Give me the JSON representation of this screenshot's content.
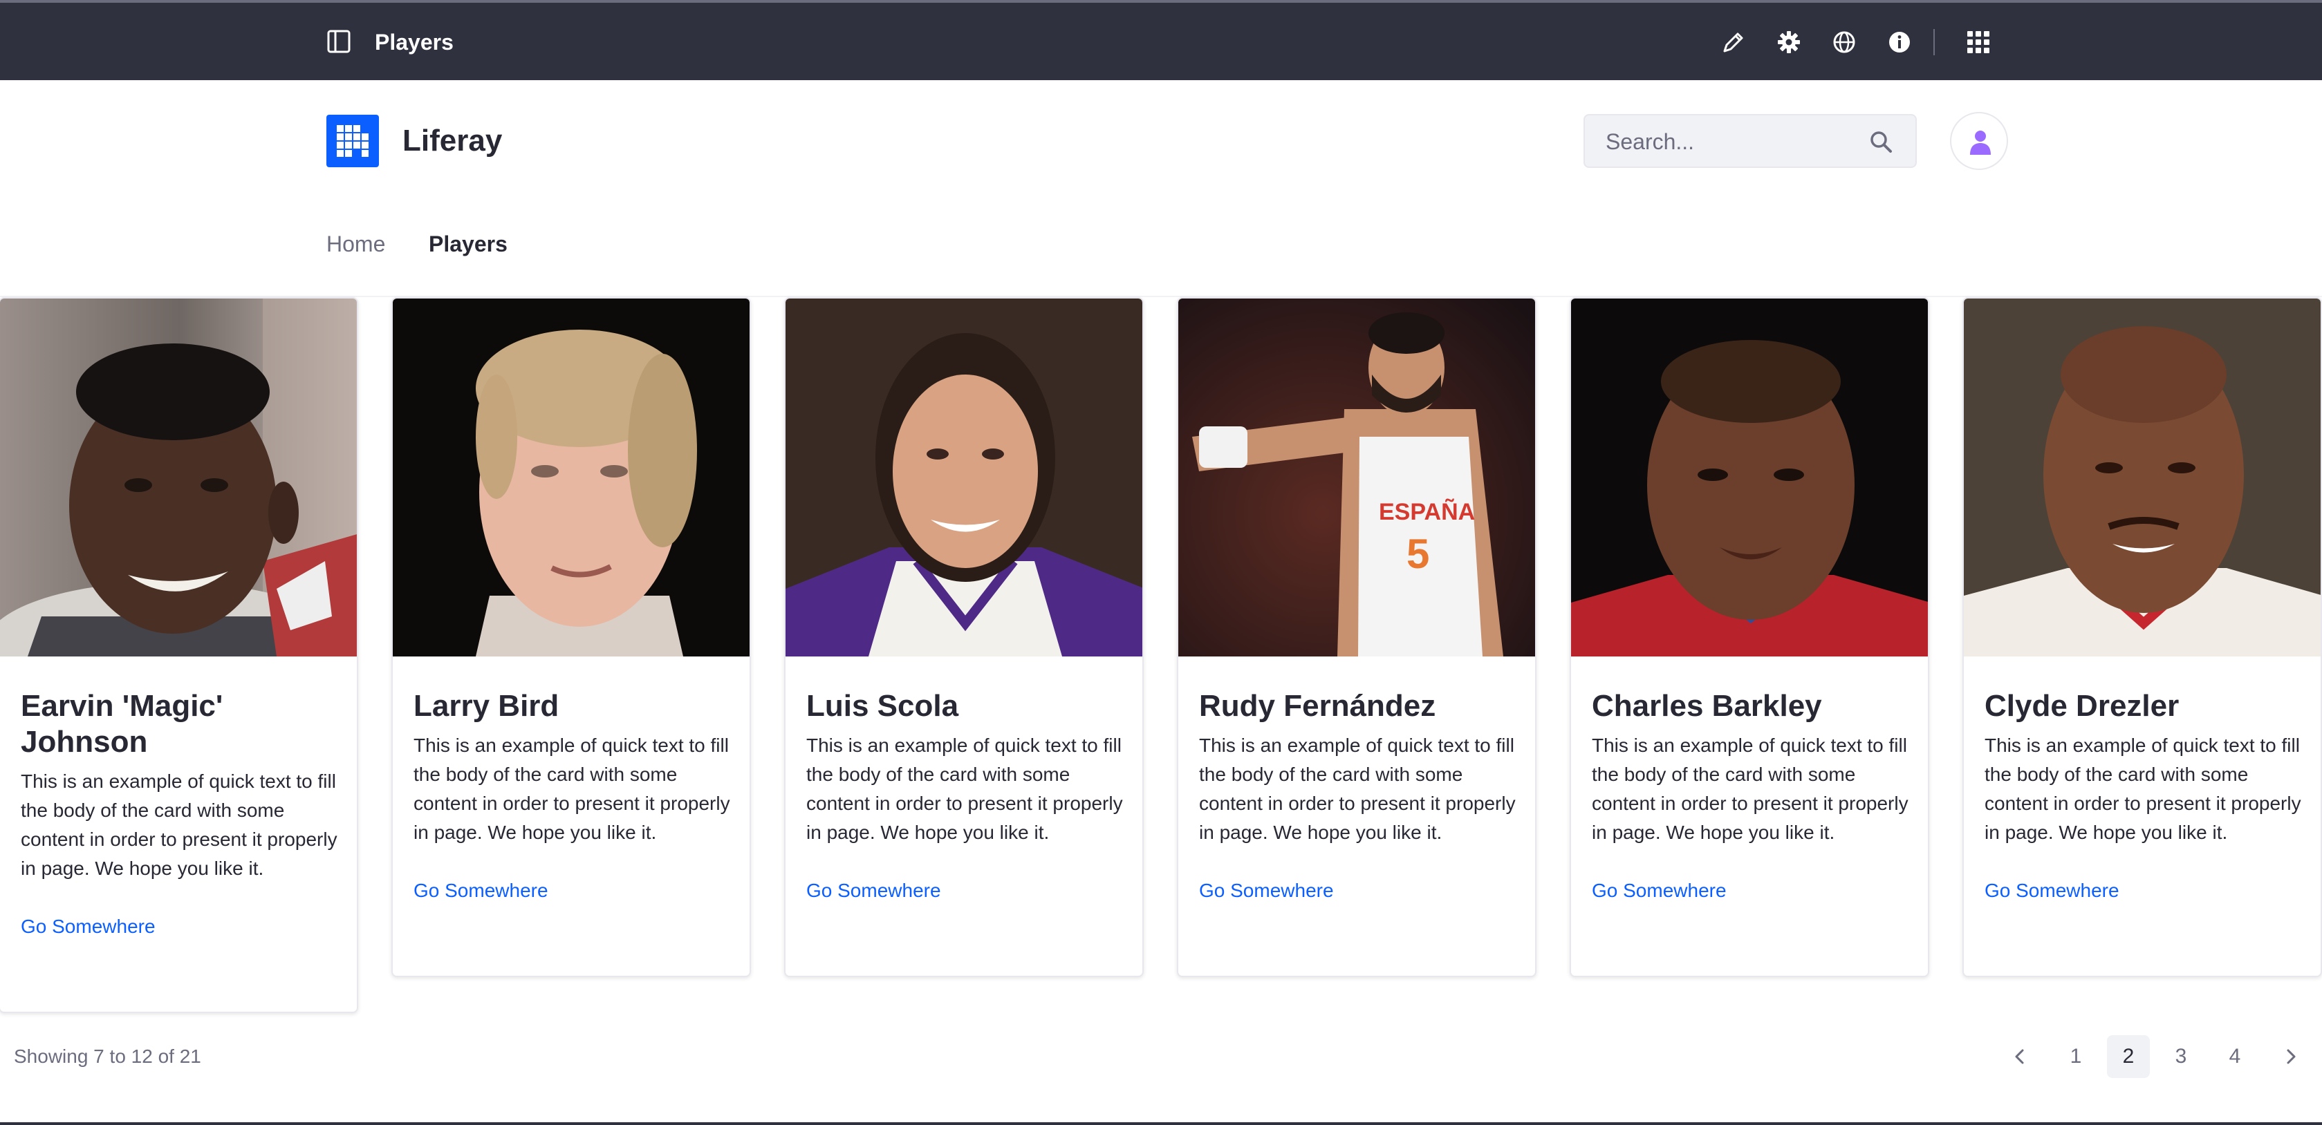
{
  "control_menu": {
    "title": "Players",
    "icons": [
      "sidebar-toggle-icon",
      "pencil-icon",
      "gear-icon",
      "globe-icon",
      "info-icon",
      "apps-grid-icon"
    ]
  },
  "header": {
    "site_name": "Liferay",
    "search": {
      "placeholder": "Search...",
      "value": ""
    }
  },
  "nav": {
    "items": [
      {
        "label": "Home",
        "active": false
      },
      {
        "label": "Players",
        "active": true
      }
    ]
  },
  "cards": [
    {
      "name": "Earvin 'Magic' Johnson",
      "text": "This is an example of quick text to fill the body of the card with some content in order to present it properly in page. We hope you like it.",
      "link": "Go Somewhere"
    },
    {
      "name": "Larry Bird",
      "text": "This is an example of quick text to fill the body of the card with some content in order to present it properly in page. We hope you like it.",
      "link": "Go Somewhere"
    },
    {
      "name": "Luis Scola",
      "text": "This is an example of quick text to fill the body of the card with some content in order to present it properly in page. We hope you like it.",
      "link": "Go Somewhere"
    },
    {
      "name": "Rudy Fernández",
      "text": "This is an example of quick text to fill the body of the card with some content in order to present it properly in page. We hope you like it.",
      "link": "Go Somewhere"
    },
    {
      "name": "Charles Barkley",
      "text": "This is an example of quick text to fill the body of the card with some content in order to present it properly in page. We hope you like it.",
      "link": "Go Somewhere"
    },
    {
      "name": "Clyde Drezler",
      "text": "This is an example of quick text to fill the body of the card with some content in order to present it properly in page. We hope you like it.",
      "link": "Go Somewhere"
    }
  ],
  "pagination": {
    "results_text": "Showing 7 to 12 of 21",
    "pages": [
      "1",
      "2",
      "3",
      "4"
    ],
    "current_page": "2"
  },
  "colors": {
    "control_menu_bg": "#30313f",
    "brand_blue": "#0b5fff",
    "link_blue": "#0b5fff",
    "avatar_accent": "#9b6bff",
    "text_primary": "#272833",
    "text_secondary": "#6b6c7e"
  }
}
